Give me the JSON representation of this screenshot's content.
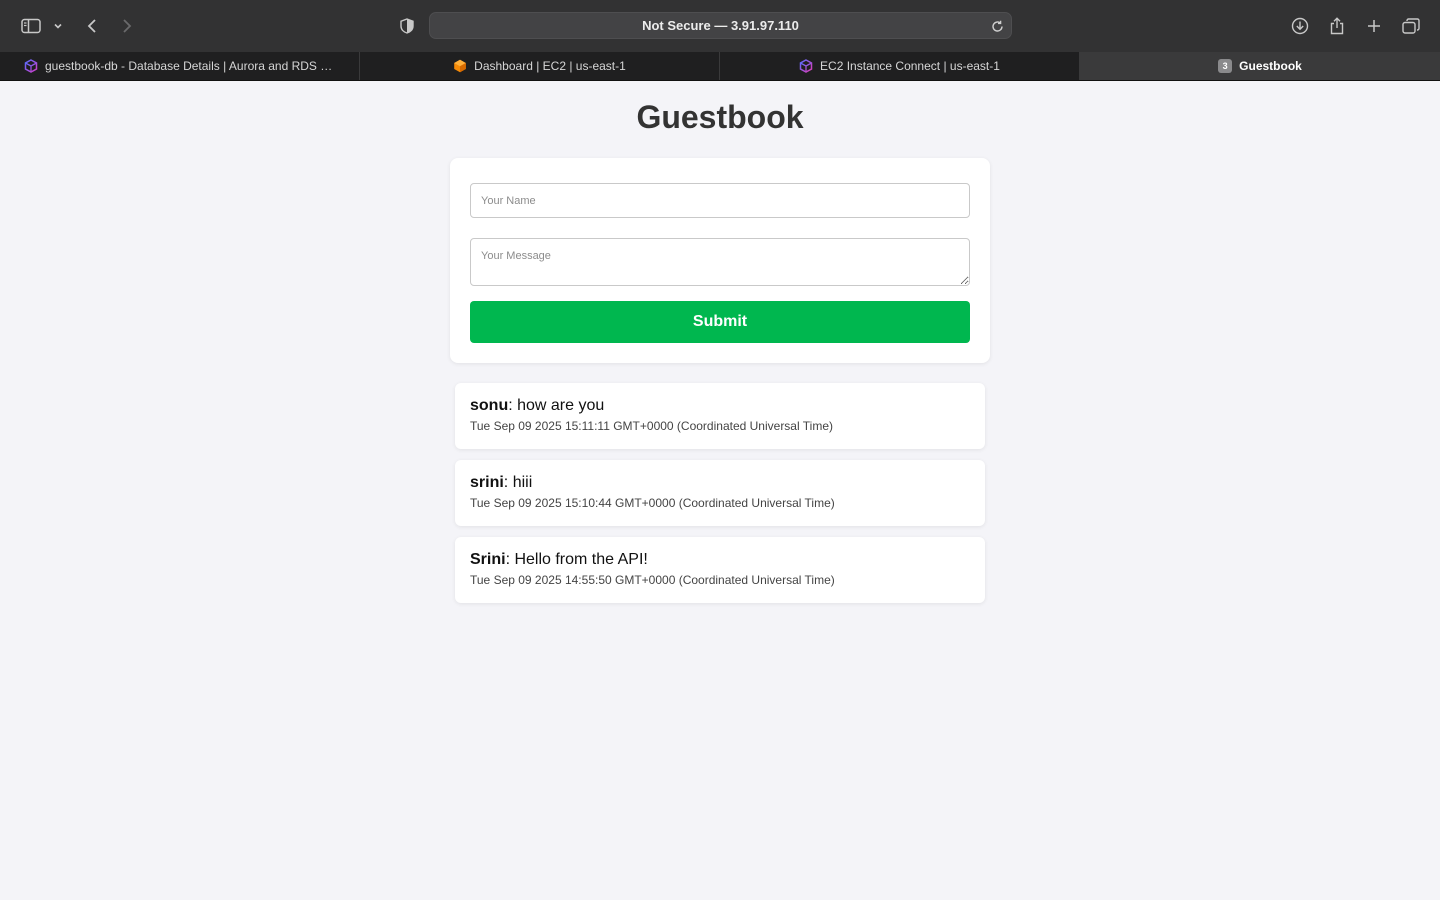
{
  "browser": {
    "address": "Not Secure — 3.91.97.110",
    "tabs": [
      {
        "label": "guestbook-db - Database Details | Aurora and RDS | us...",
        "icon": "aws-rds-icon",
        "active": false
      },
      {
        "label": "Dashboard | EC2 | us-east-1",
        "icon": "aws-ec2-icon",
        "active": false
      },
      {
        "label": "EC2 Instance Connect | us-east-1",
        "icon": "aws-ec2-connect-icon",
        "active": false
      },
      {
        "label": "Guestbook",
        "icon": "numbered-tab-icon",
        "badge": "3",
        "active": true
      }
    ]
  },
  "page": {
    "title": "Guestbook",
    "form": {
      "name_value": "",
      "name_placeholder": "Your Name",
      "message_value": "",
      "message_placeholder": "Your Message",
      "submit_label": "Submit"
    },
    "entries": [
      {
        "name": "sonu",
        "separator": ": ",
        "message": "how are you",
        "timestamp": "Tue Sep 09 2025 15:11:11 GMT+0000 (Coordinated Universal Time)"
      },
      {
        "name": "srini",
        "separator": ": ",
        "message": "hiii",
        "timestamp": "Tue Sep 09 2025 15:10:44 GMT+0000 (Coordinated Universal Time)"
      },
      {
        "name": "Srini",
        "separator": ": ",
        "message": "Hello from the API!",
        "timestamp": "Tue Sep 09 2025 14:55:50 GMT+0000 (Coordinated Universal Time)"
      }
    ]
  },
  "colors": {
    "accent_submit": "#00b74f",
    "page_background": "#f4f4f8",
    "chrome_background": "#323233"
  }
}
